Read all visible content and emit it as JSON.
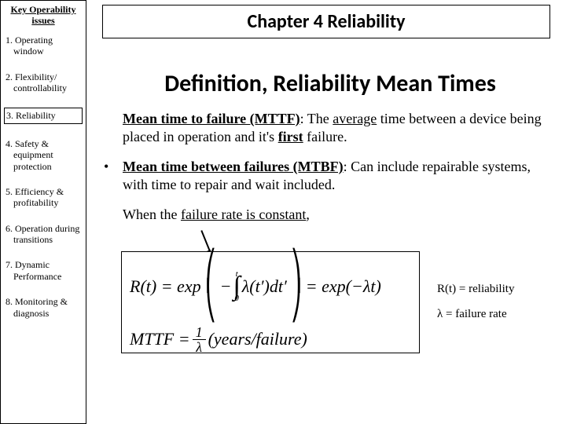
{
  "sidebar": {
    "title": "Key Operability issues",
    "items": [
      "1. Operating window",
      "2. Flexibility/ controllability",
      "3. Reliability",
      "4. Safety & equipment protection",
      "5. Efficiency & profitability",
      "6. Operation during transitions",
      "7. Dynamic Performance",
      "8. Monitoring & diagnosis"
    ],
    "active_index": 2
  },
  "chapter_title": "Chapter 4 Reliability",
  "main_heading": "Definition, Reliability Mean Times",
  "para1": {
    "term": "Mean time to failure (MTTF)",
    "after_colon": ": The ",
    "underlined1": "average",
    "mid": " time between a device being placed in operation and it's ",
    "underlined2": "first",
    "tail": " failure."
  },
  "para2": {
    "term": "Mean time between failures (MTBF)",
    "rest": ": Can include repairable systems, with time to repair and wait included."
  },
  "para3": {
    "lead": "When the ",
    "underlined": "failure rate is constant",
    "tail": ","
  },
  "formula": {
    "lhs1": "R(t) = exp",
    "neg": "−",
    "int_top": "t",
    "int_bot": "0",
    "integrand": "λ(t′)dt′",
    "eq2": " = exp(−λt)",
    "mttf_lhs": "MTTF = ",
    "mttf_num": "1",
    "mttf_den": "λ",
    "units": "  (years/failure)"
  },
  "notes": {
    "r": "R(t) = reliability",
    "lambda": "λ = failure rate"
  }
}
